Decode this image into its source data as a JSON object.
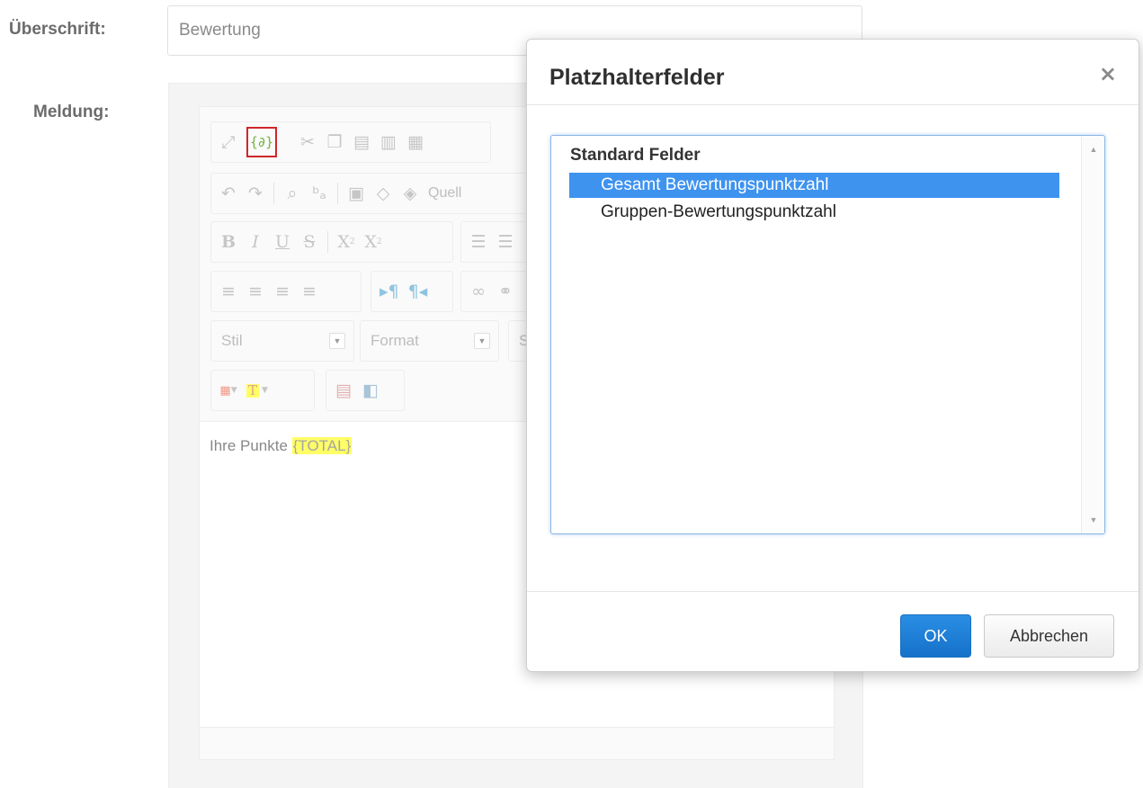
{
  "form": {
    "heading_label": "Überschrift:",
    "heading_value": "Bewertung",
    "message_label": "Meldung:"
  },
  "editor": {
    "source_label": "Quell",
    "style_label": "Stil",
    "format_label": "Format",
    "size_partial": "S",
    "content_prefix": "Ihre Punkte",
    "content_placeholder": "{TOTAL}",
    "placeholder_button_icon": "{∂}",
    "bold": "B",
    "italic": "I",
    "underline": "U",
    "strike": "S",
    "subscript": "X",
    "superscript": "X",
    "text_color": "T"
  },
  "dialog": {
    "title": "Platzhalterfelder",
    "close_symbol": "×",
    "group_label": "Standard Felder",
    "options": [
      {
        "label": "Gesamt Bewertungspunktzahl",
        "selected": true
      },
      {
        "label": "Gruppen-Bewertungspunktzahl",
        "selected": false
      }
    ],
    "ok_label": "OK",
    "cancel_label": "Abbrechen"
  },
  "colors": {
    "selection": "#3e93ef",
    "ok_button": "#1e7fd6",
    "highlight": "#ffff66",
    "active_button_border": "#d0262b"
  }
}
